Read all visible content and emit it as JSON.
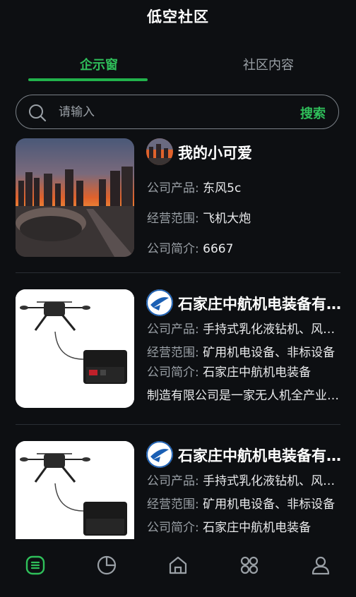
{
  "header": {
    "title": "低空社区"
  },
  "tabs": [
    {
      "label": "企示窗"
    },
    {
      "label": "社区内容"
    }
  ],
  "search": {
    "placeholder": "请输入",
    "button": "搜索"
  },
  "labels": {
    "product": "公司产品: ",
    "scope": "经营范围: ",
    "intro": "公司简介: "
  },
  "cards": [
    {
      "name": "我的小可爱",
      "product": "东风5c",
      "scope": "飞机大炮",
      "intro": "6667",
      "image": "city-sunset-photo"
    },
    {
      "name": "石家庄中航机电装备有限公司",
      "product": "手持式乳化液钻机、风动钻机",
      "scope": "矿用机电设备、非标设备",
      "intro_line1": "石家庄中航机电装备",
      "intro_line2": "制造有限公司是一家无人机全产业链企业",
      "image": "tethered-drone-photo",
      "logo": "airline-logo"
    },
    {
      "name": "石家庄中航机电装备有限公司",
      "product": "手持式乳化液钻机、风动钻机",
      "scope": "矿用机电设备、非标设备",
      "intro_line1": "石家庄中航机电装备",
      "image": "tethered-drone-photo",
      "logo": "airline-logo"
    }
  ],
  "tabbar": {
    "items": [
      "list-icon",
      "pie-chart-icon",
      "home-icon",
      "apps-icon",
      "user-icon"
    ],
    "active_color": "#2fbf5a",
    "inactive_color": "#9aa0a6"
  }
}
